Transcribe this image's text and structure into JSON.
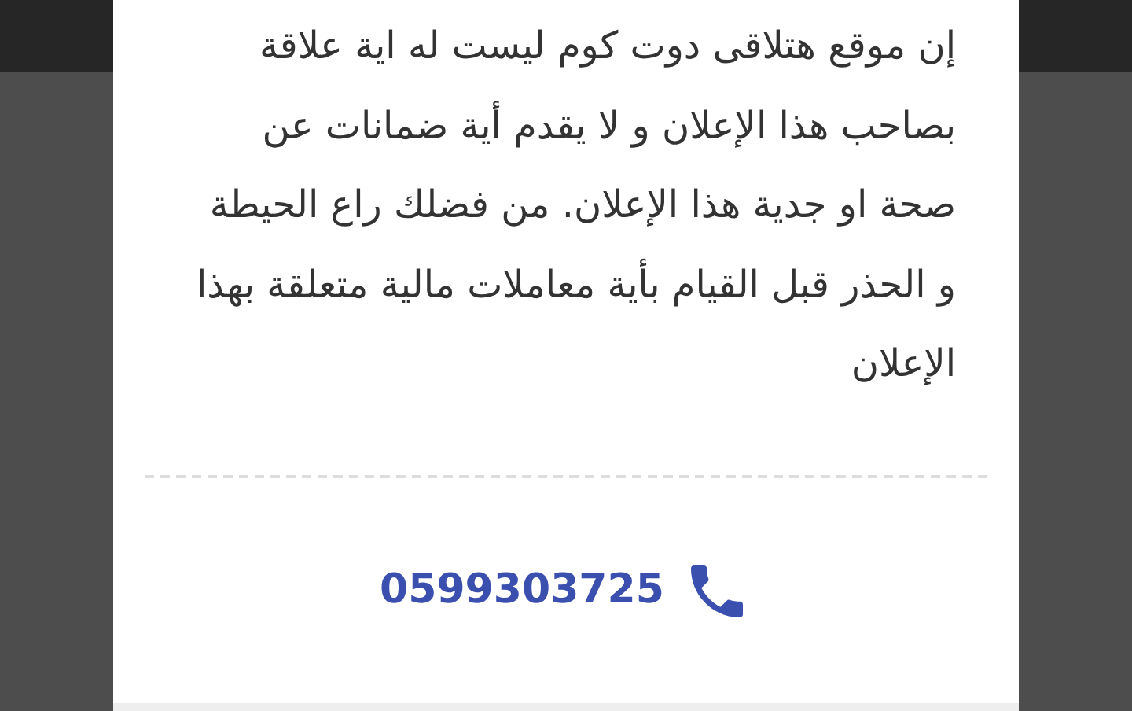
{
  "dialog": {
    "disclaimer": "إن موقع هتلاقى دوت كوم ليست له اية علاقة بصاحب هذا الإعلان و لا يقدم أية ضمانات عن صحة او جدية هذا الإعلان. من فضلك راع الحيطة و الحذر قبل القيام بأية معاملات مالية متعلقة بهذا الإعلان",
    "phone": "0599303725"
  }
}
